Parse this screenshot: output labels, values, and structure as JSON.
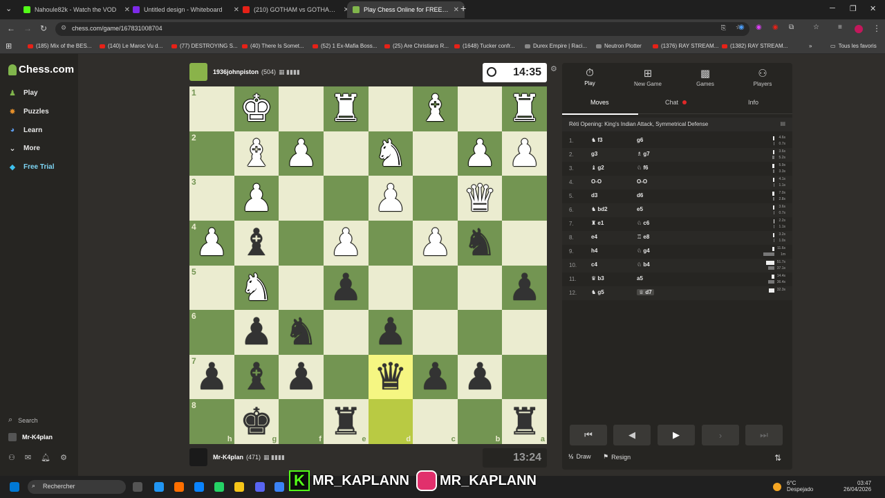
{
  "browser": {
    "tabs": [
      {
        "title": "Nahoule82k - Watch the VOD",
        "color": "#53fc18"
      },
      {
        "title": "Untitled design - Whiteboard",
        "color": "#7d2ae8"
      },
      {
        "title": "(210) GOTHAM vs GOTHAM: C",
        "color": "#e62117"
      },
      {
        "title": "Play Chess Online for FREE - 2",
        "color": "#81b64c"
      }
    ],
    "url": "chess.com/game/167831008704",
    "bookmarks": [
      "(185) Mix of the BES...",
      "(140) Le Maroc Vu d...",
      "(77) DESTROYING S...",
      "(40) There Is Somet...",
      "(52) 1 Ex-Mafia Boss...",
      "(25) Are Christians R...",
      "(1648) Tucker confr...",
      "Durex Empire | Raci...",
      "Neutron Plotter",
      "(1376) RAY STREAM...",
      "(1382) RAY STREAM...",
      "Tous les favoris"
    ]
  },
  "sidebar": {
    "logo": "Chess.com",
    "items": [
      {
        "label": "Play",
        "icon": "play-icon"
      },
      {
        "label": "Puzzles",
        "icon": "puzzle-icon"
      },
      {
        "label": "Learn",
        "icon": "learn-icon"
      },
      {
        "label": "More",
        "icon": "chevron-down-icon"
      },
      {
        "label": "Free Trial",
        "icon": "diamond-icon"
      }
    ],
    "search_label": "Search",
    "user": "Mr-K4plan"
  },
  "top_player": {
    "name": "1936johnpiston",
    "rating": "(504)",
    "clock": "14:35"
  },
  "bottom_player": {
    "name": "Mr-K4plan",
    "rating": "(471)",
    "clock": "13:24"
  },
  "board": {
    "ranks": [
      "1",
      "2",
      "3",
      "4",
      "5",
      "6",
      "7",
      "8"
    ],
    "files": [
      "h",
      "g",
      "f",
      "e",
      "d",
      "c",
      "b",
      "a"
    ],
    "rows": [
      [
        "",
        "wK",
        "",
        "wR",
        "",
        "wB",
        "",
        "wR"
      ],
      [
        "",
        "wB",
        "wP",
        "",
        "wN",
        "",
        "wP",
        "wP"
      ],
      [
        "",
        "wP",
        "",
        "",
        "wP",
        "",
        "wQ",
        ""
      ],
      [
        "wP",
        "bB",
        "",
        "wP",
        "",
        "wP",
        "bN",
        ""
      ],
      [
        "",
        "wN",
        "",
        "bP",
        "",
        "",
        "",
        "bP"
      ],
      [
        "",
        "bP",
        "bN",
        "",
        "bP",
        "",
        "",
        ""
      ],
      [
        "bP",
        "bB",
        "bP",
        "",
        "bQ",
        "bP",
        "bP",
        ""
      ],
      [
        "",
        "bK",
        "",
        "bR",
        "",
        "",
        "",
        "bR"
      ]
    ],
    "highlights": [
      "7-4",
      "8-4"
    ]
  },
  "panel": {
    "tabs": [
      "Play",
      "New Game",
      "Games",
      "Players"
    ],
    "subtabs": [
      "Moves",
      "Chat",
      "Info"
    ],
    "opening": "Réti Opening: King's Indian Attack, Symmetrical Defense",
    "moves": [
      {
        "n": "1.",
        "w": "♞ f3",
        "b": "g6",
        "wt": "4.6s",
        "bt": "0.7s",
        "ww": 2,
        "bw": 1
      },
      {
        "n": "2.",
        "w": "g3",
        "b": "♗ g7",
        "wt": "3.6s",
        "bt": "5.2s",
        "ww": 2,
        "bw": 3
      },
      {
        "n": "3.",
        "w": "♝ g2",
        "b": "♘ f6",
        "wt": "5.9s",
        "bt": "3.3s",
        "ww": 3,
        "bw": 2
      },
      {
        "n": "4.",
        "w": "O-O",
        "b": "O-O",
        "wt": "4.1s",
        "bt": "1.1s",
        "ww": 2,
        "bw": 1
      },
      {
        "n": "5.",
        "w": "d3",
        "b": "d6",
        "wt": "7.0s",
        "bt": "2.8s",
        "ww": 3,
        "bw": 2
      },
      {
        "n": "6.",
        "w": "♞ bd2",
        "b": "e5",
        "wt": "3.6s",
        "bt": "0.7s",
        "ww": 2,
        "bw": 1
      },
      {
        "n": "7.",
        "w": "♜ e1",
        "b": "♘ c6",
        "wt": "2.2s",
        "bt": "1.1s",
        "ww": 1,
        "bw": 1
      },
      {
        "n": "8.",
        "w": "e4",
        "b": "♖ e8",
        "wt": "3.2s",
        "bt": "1.0s",
        "ww": 2,
        "bw": 1
      },
      {
        "n": "9.",
        "w": "h4",
        "b": "♘ g4",
        "wt": "11.6s",
        "bt": "1m",
        "ww": 3,
        "bw": 16
      },
      {
        "n": "10.",
        "w": "c4",
        "b": "♘ b4",
        "wt": "51.7s",
        "bt": "37.1s",
        "ww": 12,
        "bw": 9
      },
      {
        "n": "11.",
        "w": "♛ b3",
        "b": "a5",
        "wt": "14.4s",
        "bt": "36.4s",
        "ww": 4,
        "bw": 9
      },
      {
        "n": "12.",
        "w": "♞ g5",
        "b": "♕ d7",
        "wt": "32.3s",
        "bt": "",
        "ww": 8,
        "bw": 0
      }
    ],
    "draw_label": "Draw",
    "resign_label": "Resign"
  },
  "taskbar": {
    "search_placeholder": "Rechercher",
    "overlay_text_1": "MR_KAPLANN",
    "overlay_text_2": "MR_KAPLANN",
    "weather_temp": "6°C",
    "weather_desc": "Despejado",
    "time": "03:47",
    "date": "26/04/2026"
  }
}
